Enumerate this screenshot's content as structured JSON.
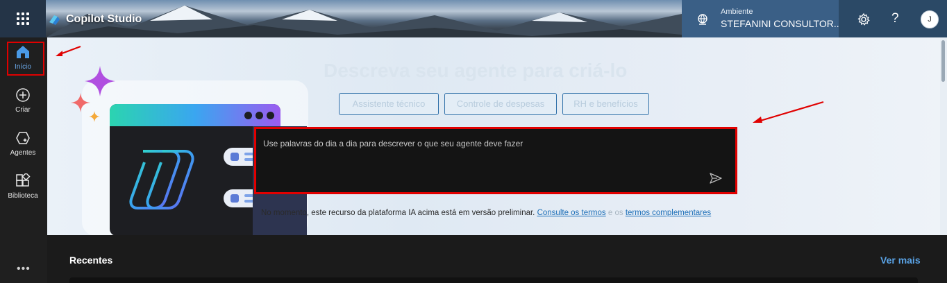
{
  "header": {
    "app_title": "Copilot Studio",
    "env_label": "Ambiente",
    "env_value": "STEFANINI CONSULTOR...",
    "help_label": "?",
    "avatar_initial": "J"
  },
  "leftnav": {
    "items": [
      {
        "label": "Início",
        "icon": "home-icon",
        "active": true
      },
      {
        "label": "Criar",
        "icon": "plus-circle-icon"
      },
      {
        "label": "Agentes",
        "icon": "agent-icon"
      },
      {
        "label": "Biblioteca",
        "icon": "library-icon"
      }
    ],
    "more_label": "•••"
  },
  "hero": {
    "title": "Descreva seu agente para criá-lo",
    "suggestions": [
      "Assistente técnico",
      "Controle de despesas",
      "RH e benefícios"
    ],
    "prompt_placeholder": "Use palavras do dia a dia para descrever o que seu agente deve fazer",
    "disclaimer_prefix": "No momento, este recurso da plataforma IA acima está em versão preliminar.",
    "disclaimer_link1": "Consulte os termos",
    "disclaimer_joiner": "e os",
    "disclaimer_link2": "termos complementares"
  },
  "recent": {
    "title": "Recentes",
    "see_more": "Ver mais"
  },
  "colors": {
    "accent": "#1d6fb8",
    "highlight_border": "#e00000"
  }
}
